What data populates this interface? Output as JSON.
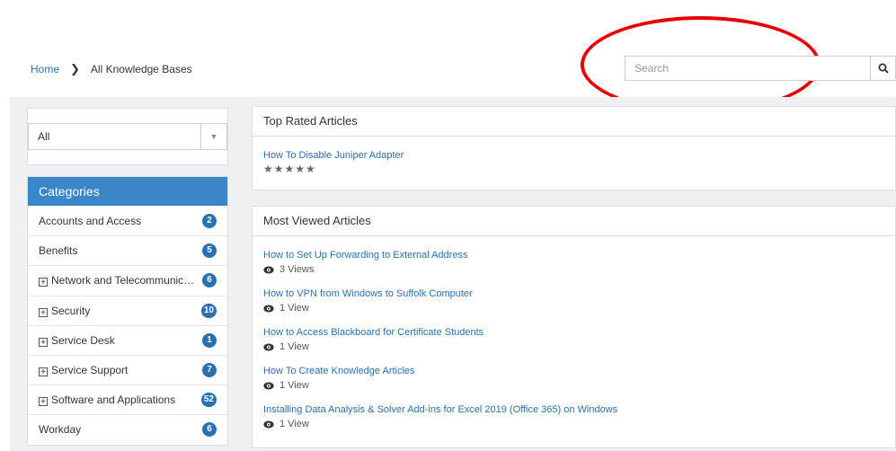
{
  "breadcrumb": {
    "home": "Home",
    "current": "All Knowledge Bases"
  },
  "search": {
    "placeholder": "Search"
  },
  "annotation": {
    "color": "#e60000"
  },
  "filter": {
    "selected": "All"
  },
  "categories": {
    "title": "Categories",
    "items": [
      {
        "label": "Accounts and Access",
        "count": "2",
        "expandable": false
      },
      {
        "label": "Benefits",
        "count": "5",
        "expandable": false
      },
      {
        "label": "Network and Telecommunicati…",
        "count": "6",
        "expandable": true
      },
      {
        "label": "Security",
        "count": "10",
        "expandable": true
      },
      {
        "label": "Service Desk",
        "count": "1",
        "expandable": true
      },
      {
        "label": "Service Support",
        "count": "7",
        "expandable": true
      },
      {
        "label": "Software and Applications",
        "count": "52",
        "expandable": true
      },
      {
        "label": "Workday",
        "count": "6",
        "expandable": false
      }
    ]
  },
  "top_rated": {
    "title": "Top Rated Articles",
    "articles": [
      {
        "title": "How To Disable Juniper Adapter",
        "stars": "★★★★★"
      }
    ]
  },
  "most_viewed": {
    "title": "Most Viewed Articles",
    "articles": [
      {
        "title": "How to Set Up Forwarding to External Address",
        "views": "3 Views"
      },
      {
        "title": "How to VPN from Windows to Suffolk Computer",
        "views": "1 View"
      },
      {
        "title": "How to Access Blackboard for Certificate Students",
        "views": "1 View"
      },
      {
        "title": "How To Create Knowledge Articles",
        "views": "1 View"
      },
      {
        "title": "Installing Data Analysis & Solver Add-ins for Excel 2019 (Office 365) on Windows",
        "views": "1 View"
      }
    ]
  },
  "colors": {
    "accent": "#3a86c8",
    "link": "#2a6fb0",
    "badge": "#2a6fb0"
  }
}
